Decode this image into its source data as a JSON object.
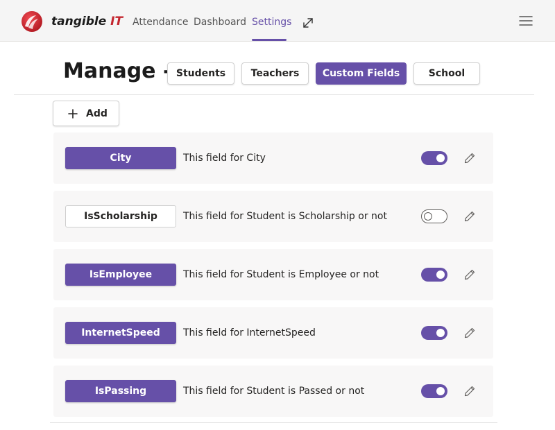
{
  "header": {
    "brand_name": "tangible",
    "brand_suffix": "IT",
    "nav": [
      {
        "label": "Attendance",
        "active": false
      },
      {
        "label": "Dashboard",
        "active": false
      },
      {
        "label": "Settings",
        "active": true
      }
    ],
    "icons": {
      "logo": "tangible-logo-icon",
      "popout": "popout-icon",
      "menu": "hamburger-menu-icon"
    }
  },
  "manage": {
    "title": "Manage -",
    "tabs": [
      {
        "label": "Students",
        "active": false
      },
      {
        "label": "Teachers",
        "active": false
      },
      {
        "label": "Custom Fields",
        "active": true
      },
      {
        "label": "School",
        "active": false
      }
    ]
  },
  "add_button": {
    "label": "Add",
    "icon": "plus-icon"
  },
  "fields": [
    {
      "name": "City",
      "description": "This field for City",
      "enabled": true
    },
    {
      "name": "IsScholarship",
      "description": "This field for Student is Scholarship or not",
      "enabled": false
    },
    {
      "name": "IsEmployee",
      "description": "This field for Student is Employee or not",
      "enabled": true
    },
    {
      "name": "InternetSpeed",
      "description": "This field for InternetSpeed",
      "enabled": true
    },
    {
      "name": "IsPassing",
      "description": "This field for Student is Passed or not",
      "enabled": true
    }
  ],
  "colors": {
    "accent": "#6650a8",
    "brand_red": "#c4262e",
    "header_bg": "#f5f5f5",
    "row_bg": "#f8f7f7"
  }
}
